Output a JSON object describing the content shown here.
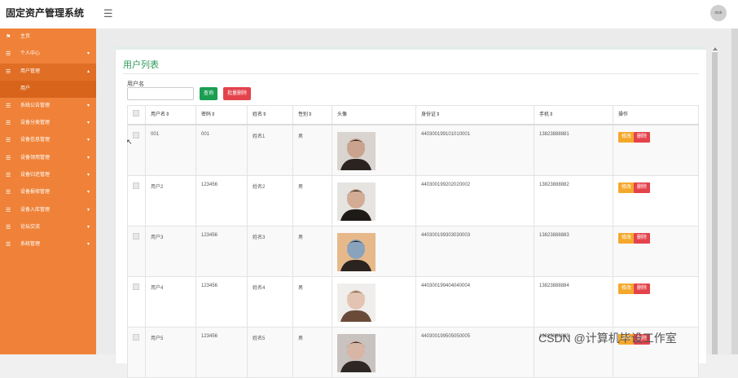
{
  "app": {
    "title": "固定资产管理系统",
    "avatar_text": "nick"
  },
  "sidebar": {
    "items": [
      {
        "label": "主页",
        "icon": "flag-icon",
        "glyph": "⚑",
        "has_children": false
      },
      {
        "label": "个人中心",
        "icon": "list-icon",
        "glyph": "☰",
        "has_children": true
      },
      {
        "label": "用户管理",
        "icon": "list-icon",
        "glyph": "☰",
        "has_children": true,
        "open": true,
        "children": [
          "用户"
        ]
      },
      {
        "label": "系统公告管理",
        "icon": "list-icon",
        "glyph": "☰",
        "has_children": true
      },
      {
        "label": "设备分类管理",
        "icon": "list-icon",
        "glyph": "☰",
        "has_children": true
      },
      {
        "label": "设备信息管理",
        "icon": "list-icon",
        "glyph": "☰",
        "has_children": true
      },
      {
        "label": "设备领用管理",
        "icon": "list-icon",
        "glyph": "☰",
        "has_children": true
      },
      {
        "label": "设备归还管理",
        "icon": "list-icon",
        "glyph": "☰",
        "has_children": true
      },
      {
        "label": "设备报修管理",
        "icon": "list-icon",
        "glyph": "☰",
        "has_children": true
      },
      {
        "label": "设备入库管理",
        "icon": "list-icon",
        "glyph": "☰",
        "has_children": true
      },
      {
        "label": "论坛交流",
        "icon": "list-icon",
        "glyph": "☰",
        "has_children": true
      },
      {
        "label": "系统管理",
        "icon": "list-icon",
        "glyph": "☰",
        "has_children": true
      }
    ]
  },
  "page": {
    "title": "用户列表",
    "search": {
      "label": "用户名",
      "value": "",
      "placeholder": ""
    },
    "query_button": "查询",
    "bulk_delete_button": "批量删除"
  },
  "table": {
    "columns": [
      "",
      "用户名⇕",
      "密码⇕",
      "姓名⇕",
      "性别⇕",
      "头像",
      "身份证⇕",
      "手机⇕",
      "操作"
    ],
    "edit_label": "修改",
    "delete_label": "删除",
    "rows": [
      {
        "username": "001",
        "password": "001",
        "name": "姓名1",
        "gender": "男",
        "id_card": "440300199101010001",
        "phone": "13823888881",
        "photo_colors": [
          "#d9d4cf",
          "#2a2320",
          "#c9a38d"
        ]
      },
      {
        "username": "用户2",
        "password": "123456",
        "name": "姓名2",
        "gender": "男",
        "id_card": "440300199202020002",
        "phone": "13823888882",
        "photo_colors": [
          "#e6e4e1",
          "#1e1a18",
          "#d2ac95"
        ]
      },
      {
        "username": "用户3",
        "password": "123456",
        "name": "姓名3",
        "gender": "男",
        "id_card": "440300199303030003",
        "phone": "13823888883",
        "photo_colors": [
          "#e7b98a",
          "#2b2320",
          "#8aa3bd"
        ]
      },
      {
        "username": "用户4",
        "password": "123456",
        "name": "姓名4",
        "gender": "男",
        "id_card": "440300199404040004",
        "phone": "13823888884",
        "photo_colors": [
          "#f0eeec",
          "#6a4b3a",
          "#e3c4b2"
        ]
      },
      {
        "username": "用户5",
        "password": "123456",
        "name": "姓名5",
        "gender": "男",
        "id_card": "440300199505050005",
        "phone": "13823888885",
        "photo_colors": [
          "#c8c3c0",
          "#2e2724",
          "#d7b6a6"
        ]
      }
    ]
  },
  "watermark": "CSDN @计算机毕设工作室",
  "colors": {
    "sidebar": "#ef8238",
    "title": "#2e9a5b",
    "query": "#1b9e52",
    "danger": "#e4434b",
    "warning": "#f4a82b"
  }
}
